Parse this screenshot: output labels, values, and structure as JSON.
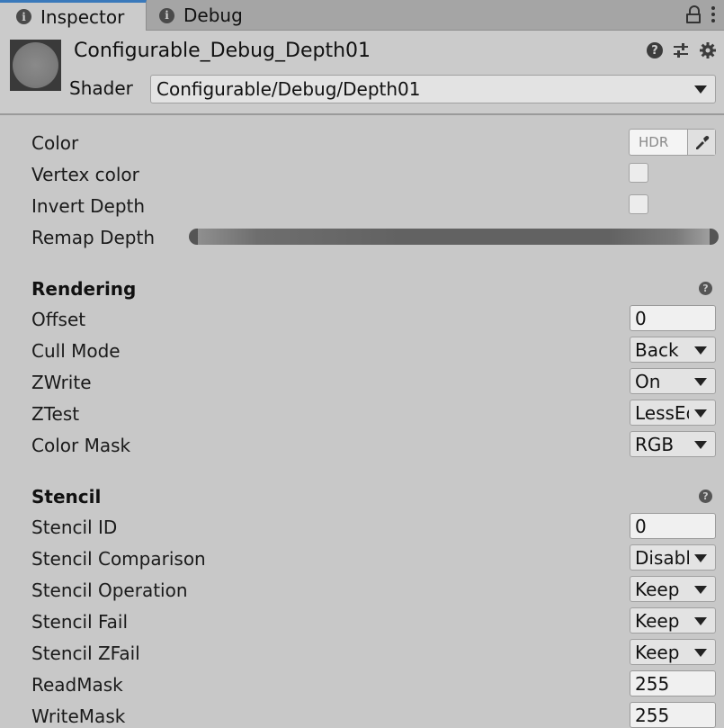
{
  "tabs": [
    {
      "label": "Inspector",
      "icon": "info-icon",
      "active": true
    },
    {
      "label": "Debug",
      "icon": "info-icon",
      "active": false
    }
  ],
  "header": {
    "material_name": "Configurable_Debug_Depth01",
    "shader_label": "Shader",
    "shader_value": "Configurable/Debug/Depth01"
  },
  "properties": {
    "color": {
      "label": "Color",
      "hdr_text": "HDR"
    },
    "vertex_color": {
      "label": "Vertex color",
      "checked": false
    },
    "invert_depth": {
      "label": "Invert Depth",
      "checked": false
    },
    "remap_depth": {
      "label": "Remap Depth",
      "range": [
        0,
        1
      ]
    }
  },
  "rendering": {
    "title": "Rendering",
    "offset": {
      "label": "Offset",
      "value": "0"
    },
    "cull_mode": {
      "label": "Cull Mode",
      "value": "Back"
    },
    "zwrite": {
      "label": "ZWrite",
      "value": "On"
    },
    "ztest": {
      "label": "ZTest",
      "value": "LessEqual"
    },
    "color_mask": {
      "label": "Color Mask",
      "value": "RGB"
    }
  },
  "stencil": {
    "title": "Stencil",
    "stencil_id": {
      "label": "Stencil ID",
      "value": "0"
    },
    "comparison": {
      "label": "Stencil Comparison",
      "value": "Disabled"
    },
    "operation": {
      "label": "Stencil Operation",
      "value": "Keep"
    },
    "fail": {
      "label": "Stencil Fail",
      "value": "Keep"
    },
    "zfail": {
      "label": "Stencil ZFail",
      "value": "Keep"
    },
    "read_mask": {
      "label": "ReadMask",
      "value": "255"
    },
    "write_mask": {
      "label": "WriteMask",
      "value": "255"
    }
  },
  "colors": {
    "accent": "#3a79bb",
    "panel": "#c8c8c8"
  }
}
